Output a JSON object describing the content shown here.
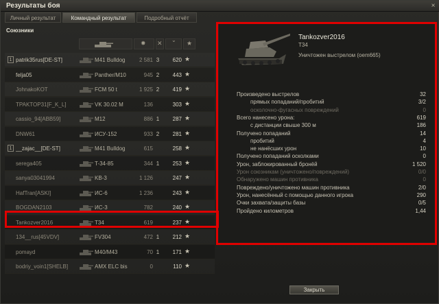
{
  "window": {
    "title": "Результаты боя",
    "close_glyph": "×"
  },
  "tabs": [
    {
      "label": "Личный результат",
      "active": false
    },
    {
      "label": "Командный результат",
      "active": true
    },
    {
      "label": "Подробный отчёт",
      "active": false
    }
  ],
  "team": {
    "title": "Союзники",
    "columns_icons": [
      "tank-silhouette-icon",
      "damage-icon",
      "kills-icon",
      "sort-chevron-icon",
      "star-icon"
    ],
    "rows": [
      {
        "platoon": "1",
        "name": "patrik35rus[DE-ST]",
        "tank": "M41 Bulldog",
        "dmg": "2 581",
        "kills": "3",
        "xp": "620",
        "dead": false
      },
      {
        "platoon": "",
        "name": "felja05",
        "tank": "Panther/M10",
        "dmg": "945",
        "kills": "2",
        "xp": "443",
        "dead": false
      },
      {
        "platoon": "",
        "name": "JohnakoKOT",
        "tank": "FCM 50 t",
        "dmg": "1 925",
        "kills": "2",
        "xp": "419",
        "dead": true
      },
      {
        "platoon": "",
        "name": "TPAKTOP31[F_K_L]",
        "tank": "VK 30.02 M",
        "dmg": "136",
        "kills": "",
        "xp": "303",
        "dead": true
      },
      {
        "platoon": "",
        "name": "cassio_94[ABB59]",
        "tank": "M12",
        "dmg": "886",
        "kills": "1",
        "xp": "287",
        "dead": true
      },
      {
        "platoon": "",
        "name": "DNW61",
        "tank": "ИСУ-152",
        "dmg": "933",
        "kills": "2",
        "xp": "281",
        "dead": true
      },
      {
        "platoon": "1",
        "name": "__zajac__[DE-ST]",
        "tank": "M41 Bulldog",
        "dmg": "615",
        "kills": "",
        "xp": "258",
        "dead": false
      },
      {
        "platoon": "",
        "name": "serega405",
        "tank": "T-34-85",
        "dmg": "344",
        "kills": "1",
        "xp": "253",
        "dead": true
      },
      {
        "platoon": "",
        "name": "sanya03041994",
        "tank": "KB-3",
        "dmg": "1 126",
        "kills": "",
        "xp": "247",
        "dead": true
      },
      {
        "platoon": "",
        "name": "HafTran[ASKI]",
        "tank": "ИС-6",
        "dmg": "1 236",
        "kills": "",
        "xp": "243",
        "dead": true
      },
      {
        "platoon": "",
        "name": "BOGDAN2103",
        "tank": "ИС-3",
        "dmg": "782",
        "kills": "",
        "xp": "240",
        "dead": true
      },
      {
        "platoon": "",
        "name": "Tankozver2016",
        "tank": "T34",
        "dmg": "619",
        "kills": "",
        "xp": "237",
        "dead": true
      },
      {
        "platoon": "",
        "name": "134__rus[45VDV]",
        "tank": "FV304",
        "dmg": "472",
        "kills": "1",
        "xp": "212",
        "dead": true
      },
      {
        "platoon": "",
        "name": "pomayd",
        "tank": "M40/M43",
        "dmg": "70",
        "kills": "1",
        "xp": "171",
        "dead": true
      },
      {
        "platoon": "",
        "name": "bodriy_voin1[SHELB]",
        "tank": "AMX ELC bis",
        "dmg": "0",
        "kills": "",
        "xp": "110",
        "dead": true
      }
    ]
  },
  "detail": {
    "player": "Tankozver2016",
    "tank": "T34",
    "status": "Уничтожен выстрелом (oem665)",
    "stats": [
      {
        "label": "Произведено выстрелов",
        "value": "32",
        "sub": false,
        "dim": false
      },
      {
        "label": "прямых попаданий/пробитий",
        "value": "3/2",
        "sub": true,
        "dim": false
      },
      {
        "label": "осколочно-фугасных повреждений",
        "value": "0",
        "sub": true,
        "dim": true
      },
      {
        "label": "Всего нанесено урона:",
        "value": "619",
        "sub": false,
        "dim": false
      },
      {
        "label": "с дистанции свыше 300 м",
        "value": "186",
        "sub": true,
        "dim": false
      },
      {
        "label": "Получено попаданий",
        "value": "14",
        "sub": false,
        "dim": false
      },
      {
        "label": "пробитий",
        "value": "4",
        "sub": true,
        "dim": false
      },
      {
        "label": "не нанёсших урон",
        "value": "10",
        "sub": true,
        "dim": false
      },
      {
        "label": "Получено попаданий осколками",
        "value": "0",
        "sub": false,
        "dim": false
      },
      {
        "label": "Урон, заблокированный бронёй",
        "value": "1 520",
        "sub": false,
        "dim": false
      },
      {
        "label": "Урон союзникам (уничтожено/повреждений)",
        "value": "0/0",
        "sub": false,
        "dim": true
      },
      {
        "label": "Обнаружено машин противника",
        "value": "0",
        "sub": false,
        "dim": true
      },
      {
        "label": "Повреждено/уничтожено машин противника",
        "value": "2/0",
        "sub": false,
        "dim": false
      },
      {
        "label": "Урон, нанесённый с помощью данного игрока",
        "value": "290",
        "sub": false,
        "dim": false
      },
      {
        "label": "Очки захвата/защиты базы",
        "value": "0/5",
        "sub": false,
        "dim": false
      },
      {
        "label": "Пройдено километров",
        "value": "1,44",
        "sub": false,
        "dim": false
      }
    ]
  },
  "close_button": "Закрыть",
  "colors": {
    "highlight": "#e00000",
    "background": "#1b1b19",
    "text": "#c8c3b4"
  }
}
